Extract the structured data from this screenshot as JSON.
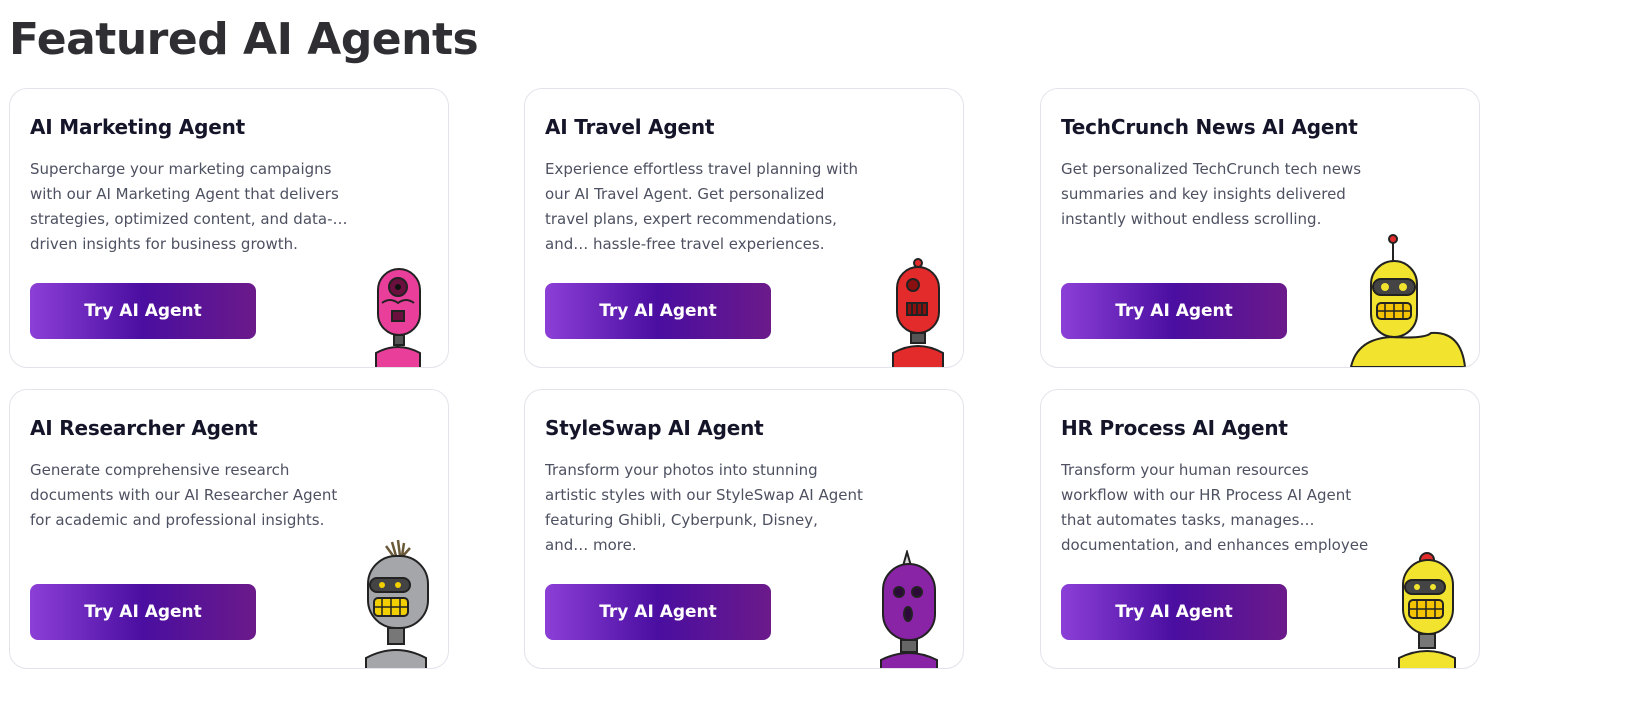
{
  "page": {
    "title": "Featured AI Agents"
  },
  "cards": [
    {
      "title": "AI Marketing Agent",
      "description": "Supercharge your marketing campaigns with our AI Marketing Agent that delivers strategies, optimized content, and data-… driven insights for business growth.",
      "button": "Try AI Agent",
      "robot": "pink-robot-icon"
    },
    {
      "title": "AI Travel Agent",
      "description": "Experience effortless travel planning with our AI Travel Agent. Get personalized travel plans, expert recommendations, and… hassle-free travel experiences.",
      "button": "Try AI Agent",
      "robot": "red-robot-icon"
    },
    {
      "title": "TechCrunch News AI Agent",
      "description": "Get personalized TechCrunch tech news summaries and key insights delivered instantly without endless scrolling.",
      "button": "Try AI Agent",
      "robot": "yellow-robot-icon"
    },
    {
      "title": "AI Researcher Agent",
      "description": "Generate comprehensive research documents with our AI Researcher Agent for academic and professional insights.",
      "button": "Try AI Agent",
      "robot": "gray-robot-icon"
    },
    {
      "title": "StyleSwap AI Agent",
      "description": "Transform your photos into stunning artistic styles with our StyleSwap AI Agent featuring Ghibli, Cyberpunk, Disney, and… more.",
      "button": "Try AI Agent",
      "robot": "purple-robot-icon"
    },
    {
      "title": "HR Process AI Agent",
      "description": "Transform your human resources workflow with our HR Process AI Agent that automates tasks, manages… documentation, and enhances employee experiences.",
      "button": "Try AI Agent",
      "robot": "yellow-robot-icon"
    }
  ],
  "colors": {
    "button_gradient": [
      "#8c3fd6",
      "#4a0ea0",
      "#6b1a8a"
    ],
    "pink": "#e93f9b",
    "red": "#e32b2b",
    "yellow": "#f2e32e",
    "gray": "#a5a6aa",
    "purple": "#8a24a6"
  }
}
